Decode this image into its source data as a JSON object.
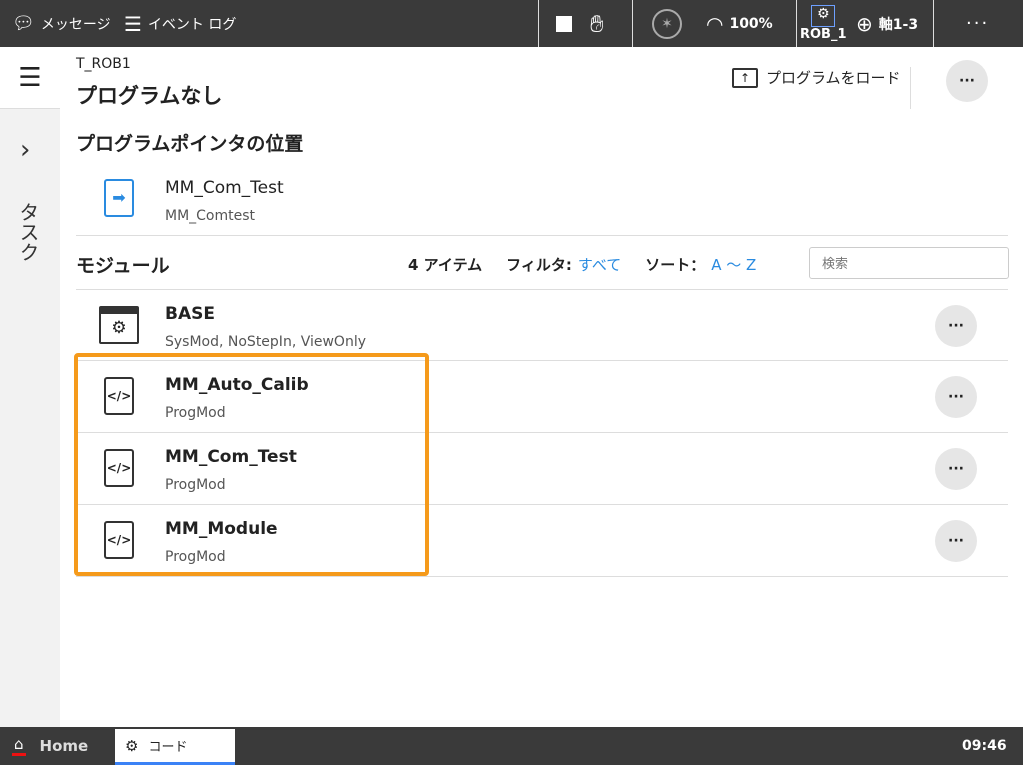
{
  "topbar": {
    "messages": "メッセージ",
    "event_log": "イベント ログ",
    "speed": "100%",
    "robot": "ROB_1",
    "axis": "軸1-3",
    "more": "···"
  },
  "sidebar": {
    "task_label": "タスク"
  },
  "header": {
    "task": "T_ROB1",
    "program": "プログラムなし",
    "load_program": "プログラムをロード",
    "more": "···"
  },
  "pointer": {
    "title": "プログラムポインタの位置",
    "name": "MM_Com_Test",
    "sub": "MM_Comtest"
  },
  "modules": {
    "title": "モジュール",
    "count": "4 アイテム",
    "filter_label": "フィルタ:",
    "filter_value": "すべて",
    "sort_label": "ソート：",
    "sort_value": "A 〜 Z",
    "search_placeholder": "検索",
    "items": [
      {
        "name": "BASE",
        "sub": "SysMod, NoStepIn, ViewOnly",
        "icon": "system-module-icon"
      },
      {
        "name": "MM_Auto_Calib",
        "sub": "ProgMod",
        "icon": "code-file-icon"
      },
      {
        "name": "MM_Com_Test",
        "sub": "ProgMod",
        "icon": "code-file-icon"
      },
      {
        "name": "MM_Module",
        "sub": "ProgMod",
        "icon": "code-file-icon"
      }
    ]
  },
  "bottom": {
    "home": "Home",
    "code_tab": "コード",
    "time": "09:46"
  },
  "colors": {
    "accent": "#2a8be0",
    "highlight": "#f59a1b",
    "home_underline": "#e11"
  }
}
